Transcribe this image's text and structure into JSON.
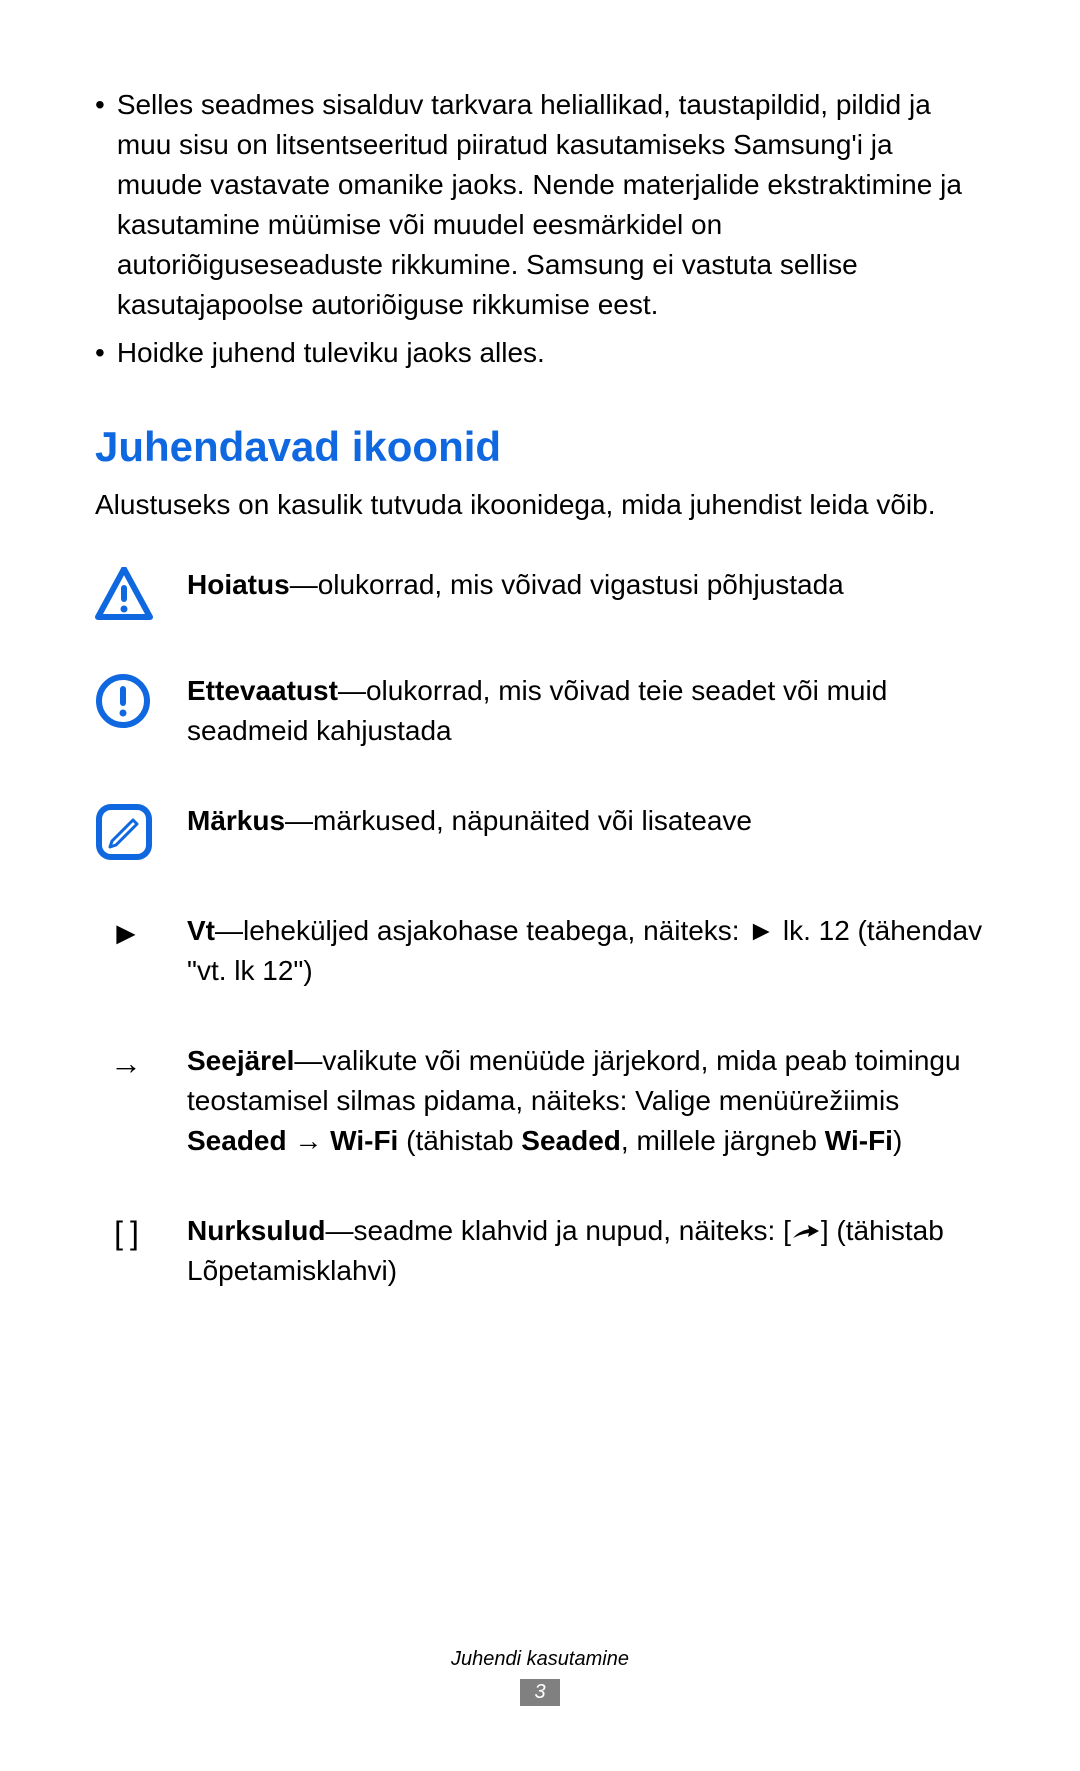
{
  "bullets": [
    "Selles seadmes sisalduv tarkvara heliallikad, taustapildid, pildid ja muu sisu on litsentseeritud piiratud kasutamiseks Samsung'i ja muude vastavate omanike jaoks. Nende materjalide ekstraktimine ja kasutamine müümise või muudel eesmärkidel on autoriõiguseseaduste rikkumine. Samsung ei vastuta sellise kasutajapoolse autoriõiguse rikkumise eest.",
    "Hoidke juhend tuleviku jaoks alles."
  ],
  "heading": "Juhendavad ikoonid",
  "intro": "Alustuseks on kasulik tutvuda ikoonidega, mida juhendist leida võib.",
  "rows": {
    "warning": {
      "bold": "Hoiatus",
      "text": "—olukorrad, mis võivad vigastusi põhjustada"
    },
    "caution": {
      "bold": "Ettevaatust",
      "text": "—olukorrad, mis võivad teie seadet või muid seadmeid kahjustada"
    },
    "note": {
      "bold": "Märkus",
      "text": "—märkused, näpunäited või lisateave"
    },
    "refer": {
      "symbol": "►",
      "bold": "Vt",
      "text1": "—leheküljed asjakohase teabega, näiteks: ► lk. 12 (tähendav \"vt. lk 12\")"
    },
    "followed": {
      "symbol": "→",
      "bold": "Seejärel",
      "text1": "—valikute või menüüde järjekord, mida peab toimingu teostamisel silmas pidama, näiteks: Valige menüürežiimis ",
      "bold2": "Seaded",
      "text2": " → ",
      "bold3": "Wi-Fi",
      "text3": " (tähistab ",
      "bold4": "Seaded",
      "text4": ", millele järgneb ",
      "bold5": "Wi-Fi",
      "text5": ")"
    },
    "brackets": {
      "symbol": "[    ]",
      "bold": "Nurksulud",
      "text1": "—seadme klahvid ja nupud, näiteks: [",
      "text2": "] (tähistab Lõpetamisklahvi)"
    }
  },
  "footer": {
    "text": "Juhendi kasutamine",
    "page": "3"
  }
}
